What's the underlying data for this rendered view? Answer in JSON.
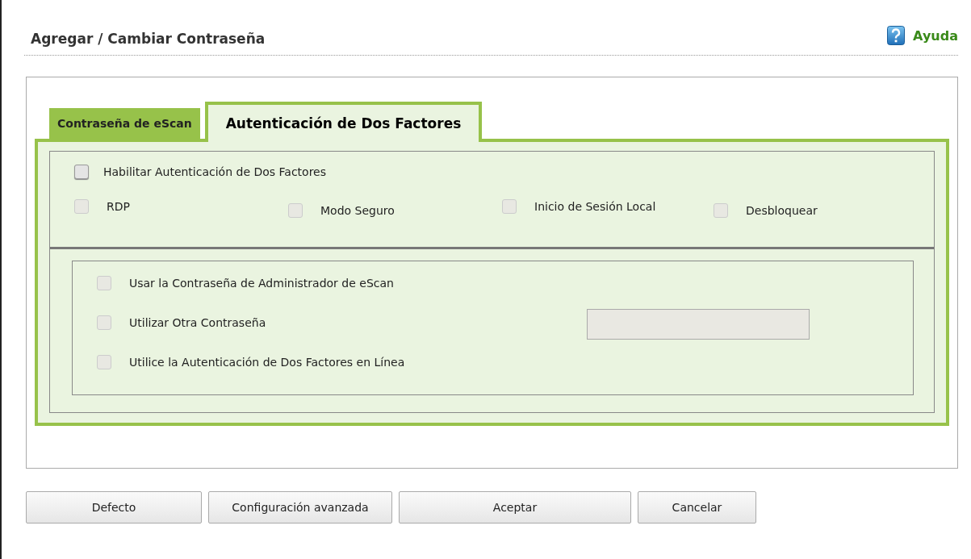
{
  "header": {
    "title": "Agregar / Cambiar Contraseña",
    "help": "Ayuda"
  },
  "tabs": [
    {
      "label": "Contraseña de eScan",
      "selected": false
    },
    {
      "label": "Autenticación de Dos Factores",
      "selected": true
    }
  ],
  "enable": {
    "label": "Habilitar Autenticación de Dos Factores",
    "checked": false,
    "disabled": false
  },
  "options": [
    {
      "label": "RDP",
      "checked": false,
      "disabled": true
    },
    {
      "label": "Modo Seguro",
      "checked": false,
      "disabled": true
    },
    {
      "label": "Inicio de Sesión Local",
      "checked": false,
      "disabled": true
    },
    {
      "label": "Desbloquear",
      "checked": false,
      "disabled": true
    }
  ],
  "password_options": [
    {
      "label": "Usar la Contraseña de Administrador de eScan",
      "checked": false,
      "disabled": true,
      "kind": "plain"
    },
    {
      "label": "Utilizar Otra Contraseña",
      "checked": false,
      "disabled": true,
      "kind": "field"
    },
    {
      "label": "Utilice la Autenticación de Dos Factores en Línea",
      "checked": false,
      "disabled": true,
      "kind": "plain"
    }
  ],
  "password_field": {
    "disabled": true
  },
  "buttons": [
    "Defecto",
    "Configuración avanzada",
    "Aceptar",
    "Cancelar"
  ]
}
